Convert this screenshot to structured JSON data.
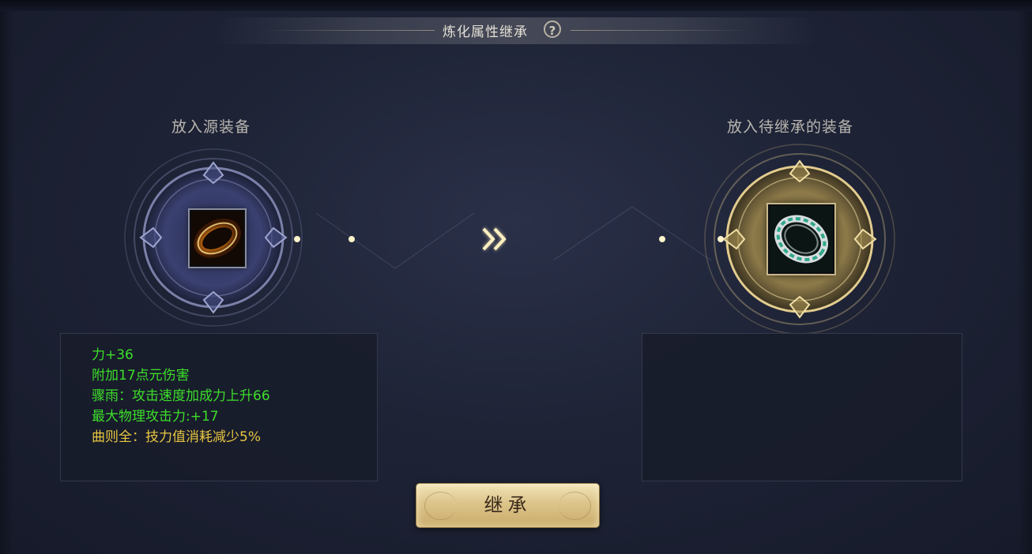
{
  "title": {
    "text": "炼化属性继承",
    "help_icon": "?"
  },
  "source_slot": {
    "label": "放入源装备",
    "item_icon": "bracelet-orange-icon",
    "attributes": [
      {
        "text": "力+36",
        "color": "#3ddf2a"
      },
      {
        "text": "附加17点元伤害",
        "color": "#3ddf2a"
      },
      {
        "text": "骤雨：攻击速度加成力上升66",
        "color": "#3ddf2a"
      },
      {
        "text": "最大物理攻击力:+17",
        "color": "#3ddf2a"
      },
      {
        "text": "曲则全：技力值消耗减少5%",
        "color": "#e8c640"
      }
    ]
  },
  "target_slot": {
    "label": "放入待继承的装备",
    "item_icon": "ring-silver-jade-icon",
    "attributes": []
  },
  "arrow_icon": "double-chevron-right-icon",
  "inherit_button": {
    "label": "继承"
  },
  "colors": {
    "accent_gold": "#e9d8a0",
    "attr_green": "#3ddf2a",
    "attr_yellow": "#e8c640",
    "background": "#1e2336"
  }
}
